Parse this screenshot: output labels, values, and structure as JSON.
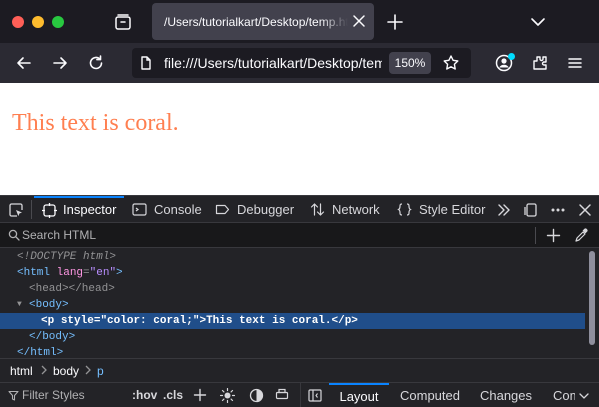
{
  "tab": {
    "title": "/Users/tutorialkart/Desktop/temp.html"
  },
  "urlbar": {
    "url": "file:///Users/tutorialkart/Desktop/temp.html",
    "zoom": "150%"
  },
  "page": {
    "text": "This text is coral.",
    "text_color": "#ff7f50"
  },
  "devtools": {
    "tabs": [
      "Inspector",
      "Console",
      "Debugger",
      "Network",
      "Style Editor"
    ],
    "search_placeholder": "Search HTML",
    "markup": {
      "doctype": "<!DOCTYPE html>",
      "html_open_tag": "<html",
      "html_attr_name": "lang",
      "html_attr_value": "\"en\"",
      "head": "<head></head>",
      "body_open": "<body>",
      "p_open_tag": "<p",
      "p_attr_name": "style",
      "p_attr_value": "\"color: coral;\"",
      "p_text": "This text is coral.",
      "p_close": "</p>",
      "body_close": "</body>",
      "html_close": "</html>"
    },
    "breadcrumbs": [
      "html",
      "body",
      "p"
    ],
    "filter_placeholder": "Filter Styles",
    "pseudo_toggle": ":hov",
    "class_toggle": ".cls",
    "sidebar_tabs": [
      "Layout",
      "Computed",
      "Changes",
      "Compatibility"
    ]
  },
  "colors": {
    "accent": "#0a84ff",
    "selection": "#204e8a",
    "tag": "#75bfff",
    "attribute": "#ff97e4",
    "attribute_value": "#b98eff"
  },
  "icons": [
    "tab-overview-icon",
    "close-icon",
    "plus-icon",
    "chevron-down-icon",
    "back-arrow-icon",
    "forward-arrow-icon",
    "reload-icon",
    "page-icon",
    "star-icon",
    "account-icon",
    "extensions-icon",
    "hamburger-menu-icon",
    "element-picker-icon",
    "inspector-icon",
    "console-icon",
    "debugger-icon",
    "network-icon",
    "style-editor-icon",
    "overflow-chevrons-icon",
    "dock-icon",
    "more-options-icon",
    "search-icon",
    "eyedropper-icon",
    "filter-icon",
    "light-mode-icon",
    "contrast-icon",
    "print-icon",
    "sidebar-toggle-icon"
  ]
}
